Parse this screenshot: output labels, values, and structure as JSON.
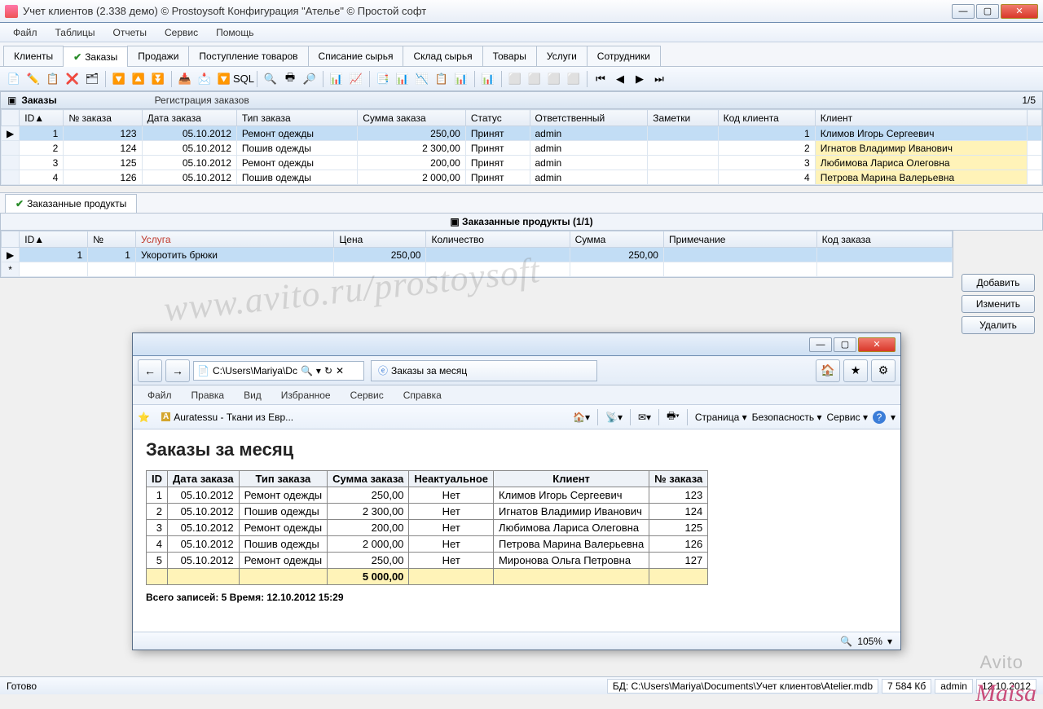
{
  "window": {
    "title": "Учет клиентов (2.338 демо) © Prostoysoft  Конфигурация \"Ателье\" © Простой софт",
    "min": "—",
    "max": "▢",
    "close": "✕"
  },
  "menu": [
    "Файл",
    "Таблицы",
    "Отчеты",
    "Сервис",
    "Помощь"
  ],
  "tabs": [
    "Клиенты",
    "Заказы",
    "Продажи",
    "Поступление товаров",
    "Списание сырья",
    "Склад сырья",
    "Товары",
    "Услуги",
    "Сотрудники"
  ],
  "tabs_active_index": 1,
  "section": {
    "title": "Заказы",
    "subtitle": "Регистрация заказов",
    "counter": "1/5"
  },
  "orders": {
    "cols": [
      "ID▲",
      "№ заказа",
      "Дата заказа",
      "Тип заказа",
      "Сумма заказа",
      "Статус",
      "Ответственный",
      "Заметки",
      "Код клиента",
      "Клиент"
    ],
    "rows": [
      {
        "id": "1",
        "num": "123",
        "date": "05.10.2012",
        "type": "Ремонт одежды",
        "sum": "250,00",
        "status": "Принят",
        "resp": "admin",
        "note": "",
        "ccode": "1",
        "client": "Климов Игорь Сергеевич",
        "sel": true
      },
      {
        "id": "2",
        "num": "124",
        "date": "05.10.2012",
        "type": "Пошив одежды",
        "sum": "2 300,00",
        "status": "Принят",
        "resp": "admin",
        "note": "",
        "ccode": "2",
        "client": "Игнатов Владимир Иванович",
        "hl": true
      },
      {
        "id": "3",
        "num": "125",
        "date": "05.10.2012",
        "type": "Ремонт одежды",
        "sum": "200,00",
        "status": "Принят",
        "resp": "admin",
        "note": "",
        "ccode": "3",
        "client": "Любимова Лариса Олеговна",
        "hl": true
      },
      {
        "id": "4",
        "num": "126",
        "date": "05.10.2012",
        "type": "Пошив одежды",
        "sum": "2 000,00",
        "status": "Принят",
        "resp": "admin",
        "note": "",
        "ccode": "4",
        "client": "Петрова Марина Валерьевна",
        "hl": true
      }
    ]
  },
  "subtab": "Заказанные продукты",
  "subsection_title": "Заказанные продукты (1/1)",
  "products": {
    "cols": [
      "ID▲",
      "№",
      "Услуга",
      "Цена",
      "Количество",
      "Сумма",
      "Примечание",
      "Код заказа"
    ],
    "rows": [
      {
        "id": "1",
        "n": "1",
        "service": "Укоротить брюки",
        "price": "250,00",
        "qty": "",
        "sum": "250,00",
        "note": "",
        "ocode": ""
      }
    ]
  },
  "buttons": {
    "add": "Добавить",
    "edit": "Изменить",
    "del": "Удалить"
  },
  "status": {
    "ready": "Готово",
    "db_label": "БД:",
    "db": "C:\\Users\\Mariya\\Documents\\Учет клиентов\\Atelier.mdb",
    "size": "7 584 Кб",
    "user": "admin",
    "date": "12.10.2012"
  },
  "ie": {
    "addr_prefix": "C:\\Users\\Mariya\\Dc",
    "search_icon": "🔍",
    "refresh_icon": "↻",
    "stop_icon": "✕",
    "tab_title": "Заказы за месяц",
    "menu": [
      "Файл",
      "Правка",
      "Вид",
      "Избранное",
      "Сервис",
      "Справка"
    ],
    "fav_item": "Auratessu - Ткани из Евр...",
    "cmdbar": [
      "Страница ▾",
      "Безопасность ▾",
      "Сервис ▾"
    ],
    "report_title": "Заказы за месяц",
    "cols": [
      "ID",
      "Дата заказа",
      "Тип заказа",
      "Сумма заказа",
      "Неактуальное",
      "Клиент",
      "№ заказа"
    ],
    "rows": [
      {
        "id": "1",
        "date": "05.10.2012",
        "type": "Ремонт одежды",
        "sum": "250,00",
        "na": "Нет",
        "client": "Климов Игорь Сергеевич",
        "num": "123"
      },
      {
        "id": "2",
        "date": "05.10.2012",
        "type": "Пошив одежды",
        "sum": "2 300,00",
        "na": "Нет",
        "client": "Игнатов Владимир Иванович",
        "num": "124"
      },
      {
        "id": "3",
        "date": "05.10.2012",
        "type": "Ремонт одежды",
        "sum": "200,00",
        "na": "Нет",
        "client": "Любимова Лариса Олеговна",
        "num": "125"
      },
      {
        "id": "4",
        "date": "05.10.2012",
        "type": "Пошив одежды",
        "sum": "2 000,00",
        "na": "Нет",
        "client": "Петрова Марина Валерьевна",
        "num": "126"
      },
      {
        "id": "5",
        "date": "05.10.2012",
        "type": "Ремонт одежды",
        "sum": "250,00",
        "na": "Нет",
        "client": "Миронова Ольга Петровна",
        "num": "127"
      }
    ],
    "total": "5 000,00",
    "footer": "Всего записей: 5     Время: 12.10.2012 15:29",
    "zoom": "105%"
  },
  "watermark": "www.avito.ru/prostoysoft",
  "avito": "Avito",
  "maisa": "Maisa"
}
